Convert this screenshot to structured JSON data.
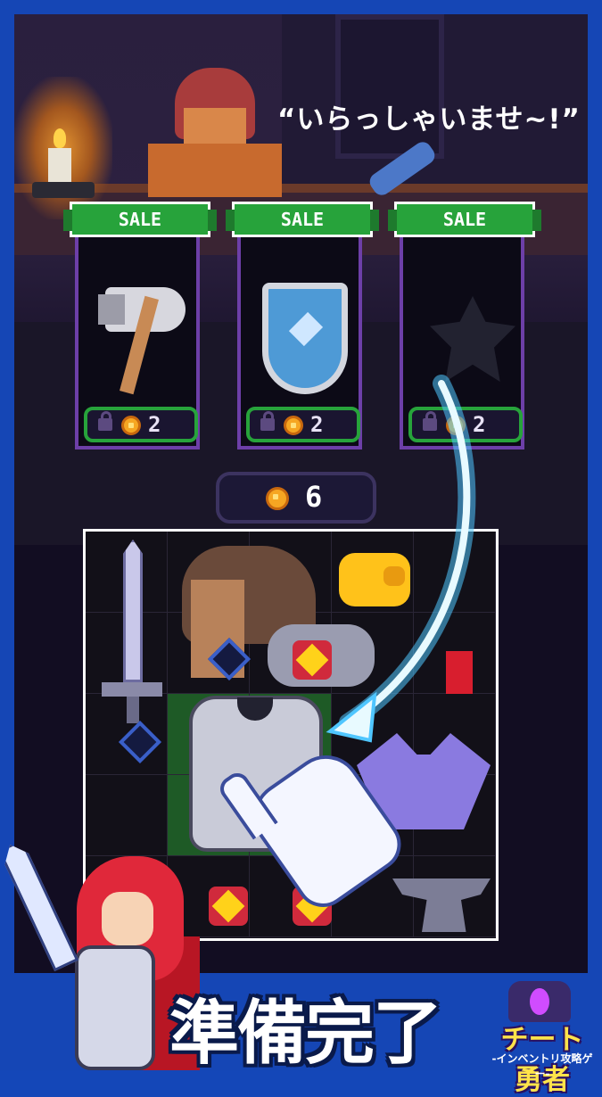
{
  "speech": "“いらっしゃいませ~!”",
  "shop": {
    "items": [
      {
        "tag": "SALE",
        "price": "2",
        "item": "axe-icon",
        "locked": true
      },
      {
        "tag": "SALE",
        "price": "2",
        "item": "shield-icon",
        "locked": true
      },
      {
        "tag": "SALE",
        "price": "2",
        "item": "unknown-item-silhouette",
        "locked": true
      }
    ]
  },
  "coins": "6",
  "inventory": {
    "rows": 5,
    "cols": 5,
    "items": [
      "sword-icon",
      "hat-icon",
      "pig-icon",
      "helmet-icon",
      "armor-icon",
      "bat-icon",
      "boot-icon",
      "gem-icon",
      "anvil-icon"
    ]
  },
  "banner": "準備完了",
  "logo": {
    "title": "チート勇者",
    "subtitle": "-インベントリ攻略ゲー-"
  },
  "colors": {
    "frame": "#1546b5",
    "sale_green": "#27a33b",
    "card_border": "#6d3fa8",
    "coin": "#f6a622"
  }
}
